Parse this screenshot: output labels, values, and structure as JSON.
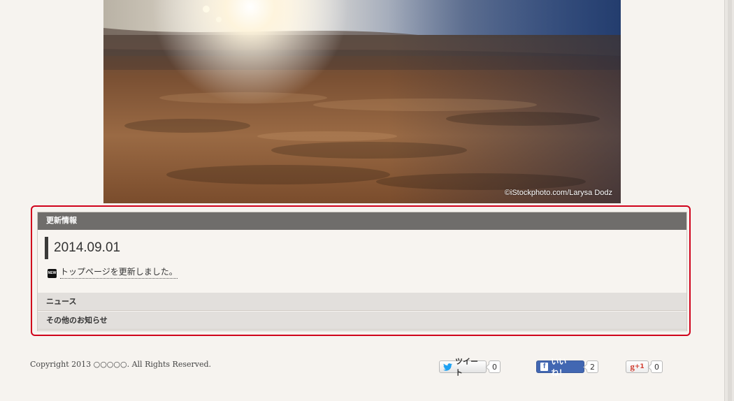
{
  "hero": {
    "credit": "©iStockphoto.com/Larysa Dodz"
  },
  "updates": {
    "header": "更新情報",
    "date": "2014.09.01",
    "badge": "NEW",
    "item_text": "トップページを更新しました。",
    "menu": [
      {
        "label": "ニュース"
      },
      {
        "label": "その他のお知らせ"
      }
    ]
  },
  "footer": {
    "copyright": "Copyright 2013 ○○○○○. All Rights Reserved."
  },
  "share": {
    "tweet": {
      "label": "ツイート",
      "count": "0",
      "icon": "twitter-bird-icon"
    },
    "like": {
      "label": "いいね！",
      "count": "2",
      "icon": "facebook-f-icon",
      "icon_text": "f"
    },
    "plusone": {
      "label": "+1",
      "count": "0",
      "icon": "google-plus-icon",
      "icon_text": "g"
    }
  },
  "colors": {
    "accent_border": "#d0021b",
    "panel_header": "#6f6d6b",
    "facebook": "#4267b2",
    "twitter": "#1da1f2",
    "google": "#d23f31"
  }
}
